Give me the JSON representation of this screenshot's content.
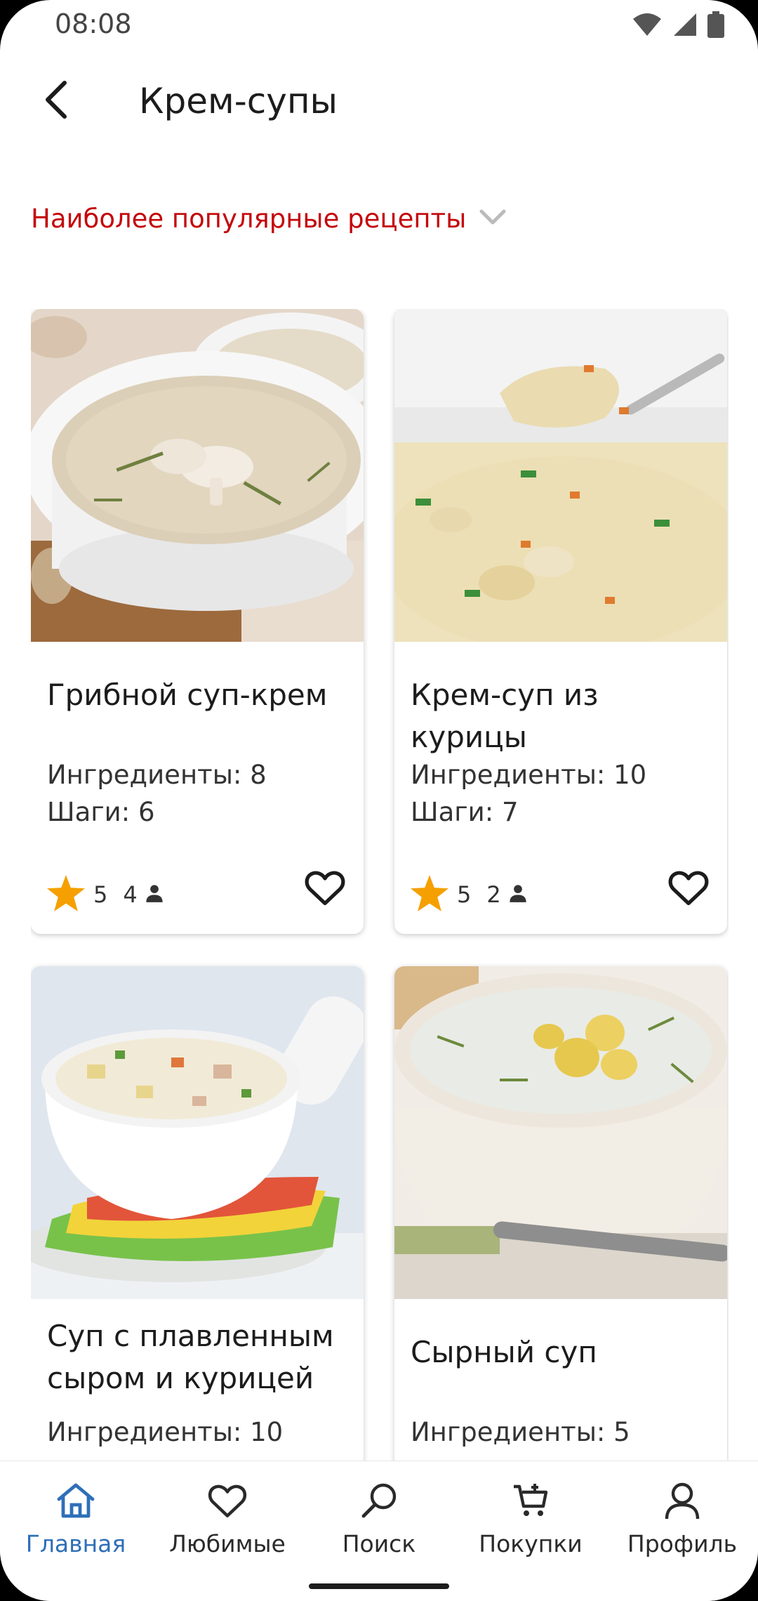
{
  "status_bar": {
    "time": "08:08",
    "icons": [
      "wifi-icon",
      "signal-icon",
      "battery-icon"
    ]
  },
  "header": {
    "back_icon": "back-arrow-icon",
    "title": "Крем-супы"
  },
  "sort": {
    "label": "Наиболее популярные рецепты",
    "icon": "chevron-down-icon",
    "color": "#c4070b"
  },
  "recipes": [
    {
      "title": "Грибной суп-крем",
      "ingredients": "Ингредиенты: 8",
      "steps": "Шаги: 6",
      "rating": "5",
      "reviews": "4",
      "favorite_icon": "heart-outline-icon"
    },
    {
      "title": "Крем-суп из курицы",
      "ingredients": "Ингредиенты: 10",
      "steps": "Шаги: 7",
      "rating": "5",
      "reviews": "2",
      "favorite_icon": "heart-outline-icon"
    },
    {
      "title": "Суп с плавленным сыром и курицей",
      "ingredients": "Ингредиенты: 10"
    },
    {
      "title": "Сырный суп",
      "ingredients": "Ингредиенты: 5"
    }
  ],
  "rating_icon": "star-icon",
  "rating_color": "#f5a000",
  "reviewer_icon": "person-icon",
  "bottom_nav": {
    "active_color": "#2f6fb8",
    "items": [
      {
        "label": "Главная",
        "icon": "home-icon",
        "active": true
      },
      {
        "label": "Любимые",
        "icon": "heart-icon",
        "active": false
      },
      {
        "label": "Поиск",
        "icon": "search-icon",
        "active": false
      },
      {
        "label": "Покупки",
        "icon": "cart-icon",
        "active": false
      },
      {
        "label": "Профиль",
        "icon": "profile-icon",
        "active": false
      }
    ]
  }
}
